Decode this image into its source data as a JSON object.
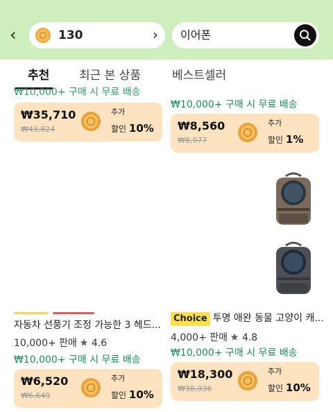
{
  "header": {
    "back_label": "‹",
    "coins": "130",
    "coin_chevron": "›",
    "search_query": "이어폰",
    "bg_color": "#cfeebe"
  },
  "tabs": [
    {
      "label": "추천",
      "active": true
    },
    {
      "label": "최근 본 상품",
      "active": false
    },
    {
      "label": "베스트셀러",
      "active": false
    }
  ],
  "products": [
    {
      "free_shipping": "₩10,000+ 구매 시 무료 배송",
      "price": "₩35,710",
      "original_price": "₩43,824",
      "extra_label": "추가",
      "discount_prefix": "할인",
      "discount": "10%"
    },
    {
      "free_shipping": "₩10,000+ 구매 시 무료 배송",
      "price": "₩8,560",
      "original_price": "₩8,977",
      "extra_label": "추가",
      "discount_prefix": "할인",
      "discount": "1%"
    },
    {
      "title": "자동차 선풍기 조정 가능한 3 헤드...",
      "sales": "10,000+ 판매",
      "rating": "4.6",
      "free_shipping": "₩10,000+ 구매 시 무료 배송",
      "price": "₩6,520",
      "original_price": "₩6,649",
      "extra_label": "추가",
      "discount_prefix": "할인",
      "discount": "10%"
    },
    {
      "badge": "Choice",
      "title": "투명 애완 동물 고양이 캐...",
      "sales": "4,000+ 판매",
      "rating": "4.8",
      "free_shipping": "₩10,000+ 구매 시 무료 배송",
      "price": "₩18,300",
      "original_price": "₩38,936",
      "extra_label": "추가",
      "discount_prefix": "할인",
      "discount": "10%"
    }
  ],
  "icons": [
    "back-icon",
    "coin-icon",
    "chevron-right-icon",
    "search-icon",
    "star-icon"
  ]
}
